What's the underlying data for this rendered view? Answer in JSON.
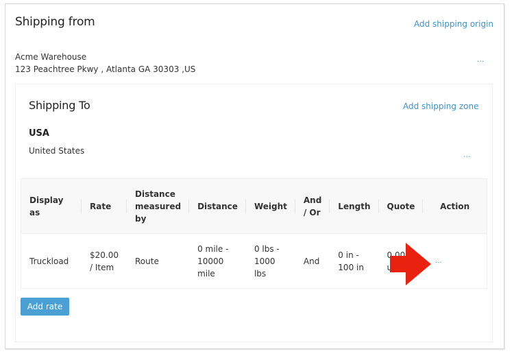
{
  "shipping_from": {
    "title": "Shipping from",
    "add_origin_label": "Add shipping origin",
    "origin": {
      "name": "Acme Warehouse",
      "address": "123 Peachtree Pkwy , Atlanta GA 30303 ,US"
    },
    "more_label": "..."
  },
  "shipping_to": {
    "title": "Shipping To",
    "add_zone_label": "Add shipping zone",
    "zone": {
      "name": "USA",
      "country": "United States"
    },
    "more_label": "..."
  },
  "rates_table": {
    "columns": [
      "Display as",
      "Rate",
      "Distance measured by",
      "Distance",
      "Weight",
      "And / Or",
      "Length",
      "Quote",
      "Action"
    ],
    "rows": [
      {
        "display_as": "Truckload",
        "rate": "$20.00 / Item",
        "distance_measured_by": "Route",
        "distance": "0 mile - 10000 mile",
        "weight": "0 lbs - 1000 lbs",
        "and_or": "And",
        "length": "0 in - 100 in",
        "quote": "0.00 - up",
        "action_label": "..."
      }
    ]
  },
  "add_rate_label": "Add rate",
  "annotation": {
    "icon": "red-arrow-right",
    "color": "#e8220e"
  },
  "colors": {
    "link": "#3a95cf",
    "button": "#4aa0d5"
  }
}
